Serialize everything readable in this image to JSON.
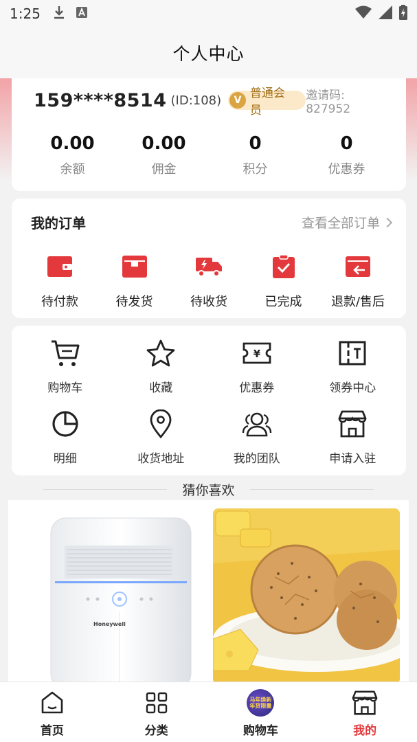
{
  "status_bar": {
    "time": "1:25"
  },
  "header": {
    "title": "个人中心"
  },
  "profile": {
    "phone": "159****8514",
    "id_text": "(ID:108)",
    "member_level": "普通会员",
    "invite_label": "邀请码:",
    "invite_code": "827952",
    "stats": [
      {
        "value": "0.00",
        "label": "余额"
      },
      {
        "value": "0.00",
        "label": "佣金"
      },
      {
        "value": "0",
        "label": "积分"
      },
      {
        "value": "0",
        "label": "优惠券"
      }
    ]
  },
  "orders": {
    "title": "我的订单",
    "view_all": "查看全部订单",
    "items": [
      {
        "label": "待付款",
        "icon": "wallet-icon"
      },
      {
        "label": "待发货",
        "icon": "box-icon"
      },
      {
        "label": "待收货",
        "icon": "truck-icon"
      },
      {
        "label": "已完成",
        "icon": "clipboard-check-icon"
      },
      {
        "label": "退款/售后",
        "icon": "refund-icon"
      }
    ]
  },
  "tools": [
    {
      "label": "购物车",
      "icon": "cart-icon"
    },
    {
      "label": "收藏",
      "icon": "star-icon"
    },
    {
      "label": "优惠券",
      "icon": "coupon-icon"
    },
    {
      "label": "领券中心",
      "icon": "ticket-icon"
    },
    {
      "label": "明细",
      "icon": "pie-chart-icon"
    },
    {
      "label": "收货地址",
      "icon": "location-pin-icon"
    },
    {
      "label": "我的团队",
      "icon": "team-icon"
    },
    {
      "label": "申请入驻",
      "icon": "store-icon"
    }
  ],
  "guess": {
    "title": "猜你喜欢"
  },
  "products": [
    {
      "brand": "Honeywell"
    },
    {
      "brand": ""
    }
  ],
  "bottom_nav": [
    {
      "label": "首页",
      "icon": "home-icon"
    },
    {
      "label": "分类",
      "icon": "category-grid-icon"
    },
    {
      "label": "购物车",
      "icon": "promo-badge-icon",
      "promo_text": "马年焕新 年货限量"
    },
    {
      "label": "我的",
      "icon": "store-icon",
      "active": true
    }
  ],
  "colors": {
    "accent": "#e4393c",
    "member_gold": "#d9a441",
    "band_pink": "#f2a3a7"
  }
}
